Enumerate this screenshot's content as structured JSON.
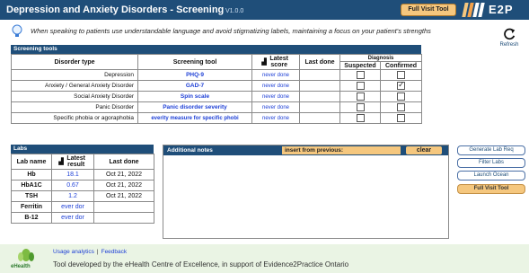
{
  "header": {
    "title": "Depression and Anxiety Disorders - Screening",
    "version": "V1.0.0",
    "full_visit_tool": "Full Visit Tool",
    "logo_text": "E2P"
  },
  "tip": {
    "text": "When speaking to patients use understandable language and avoid stigmatizing labels, maintaining a focus on your patient's strengths"
  },
  "refresh": {
    "label": "Refresh"
  },
  "screening": {
    "section_label": "Screening tools",
    "headers": {
      "disorder": "Disorder type",
      "tool": "Screening tool",
      "latest_score": "Latest score",
      "last_done": "Last done",
      "diagnosis": "Diagnosis",
      "suspected": "Suspected",
      "confirmed": "Confirmed"
    },
    "rows": [
      {
        "disorder": "Depression",
        "tool": "PHQ-9",
        "score": "never done",
        "last_done": "",
        "suspected": false,
        "confirmed": false
      },
      {
        "disorder": "Anxiety / General Anxiety Disorder",
        "tool": "GAD-7",
        "score": "never done",
        "last_done": "",
        "suspected": false,
        "confirmed": true
      },
      {
        "disorder": "Social Anxiety Disorder",
        "tool": "Spin scale",
        "score": "never done",
        "last_done": "",
        "suspected": false,
        "confirmed": false
      },
      {
        "disorder": "Panic Disorder",
        "tool": "Panic disorder severity",
        "score": "never done",
        "last_done": "",
        "suspected": false,
        "confirmed": false
      },
      {
        "disorder": "Specific phobia or agoraphobia",
        "tool": "everity measure for specific phobi",
        "score": "never done",
        "last_done": "",
        "suspected": false,
        "confirmed": false
      }
    ]
  },
  "labs": {
    "section_label": "Labs",
    "headers": {
      "name": "Lab name",
      "latest": "Latest result",
      "last_done": "Last done"
    },
    "rows": [
      {
        "name": "Hb",
        "value": "18.1",
        "date": "Oct 21, 2022"
      },
      {
        "name": "HbA1C",
        "value": "0.67",
        "date": "Oct 21, 2022"
      },
      {
        "name": "TSH",
        "value": "1.2",
        "date": "Oct 21, 2022"
      },
      {
        "name": "Ferritin",
        "value": "ever dor",
        "date": ""
      },
      {
        "name": "B-12",
        "value": "ever dor",
        "date": ""
      }
    ]
  },
  "notes": {
    "title": "Additional notes",
    "insert_label": "insert from previous:",
    "clear_label": "clear"
  },
  "side_buttons": {
    "generate_lab": "Generate Lab Req",
    "filter_labs": "Filter Labs",
    "launch_ocean": "Launch Ocean",
    "full_visit": "Full Visit Tool"
  },
  "footer": {
    "usage": "Usage analytics",
    "separator": "|",
    "feedback": "Feedback",
    "logo_text": "eHealth",
    "text": "Tool developed by the eHealth Centre of Excellence, in support of Evidence2Practice Ontario"
  },
  "colors": {
    "header_bg": "#1f4e79",
    "accent_orange": "#f5c77e",
    "link_blue": "#1d3fd6",
    "footer_bg": "#eaf4e4"
  }
}
